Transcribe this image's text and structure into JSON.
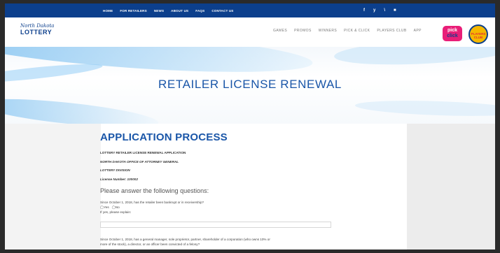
{
  "topbar": {
    "links": [
      "HOME",
      "FOR RETAILERS",
      "NEWS",
      "ABOUT US",
      "FAQS",
      "CONTACT US"
    ],
    "social": [
      "f",
      "y",
      "\\",
      "■"
    ]
  },
  "logo": {
    "line1": "North Dakota",
    "line2": "LOTTERY"
  },
  "mainnav": [
    "GAMES",
    "PROMOS",
    "WINNERS",
    "PICK & CLICK",
    "PLAYERS CLUB",
    "APP"
  ],
  "pick_click": {
    "line1": "pick",
    "line2": "click"
  },
  "players_badge": "PLAYERS CLUB",
  "hero": {
    "title": "RETAILER LICENSE RENEWAL"
  },
  "application": {
    "title": "APPLICATION PROCESS",
    "meta": [
      "LOTTERY RETAILER LICENSE RENEWAL APPLICATION",
      "NORTH DAKOTA OFFICE OF ATTORNEY GENERAL",
      "LOTTERY DIVISION",
      "License Number: 100002"
    ],
    "questions_heading": "Please answer the following questions:",
    "q1": "Since October 1, 2018, has the retailer been bankrupt or in receivership?",
    "q1_yes": "◯Yes",
    "q1_no": "◯No",
    "q1_explain": "If yes, please explain:",
    "q2_line1": "Since October 1, 2018, has a general manager, sole proprietor, partner, shareholder of a corporation (who owns 10% or",
    "q2_line2": "more of the stock), a director, or an officer been convicted of a felony?"
  }
}
